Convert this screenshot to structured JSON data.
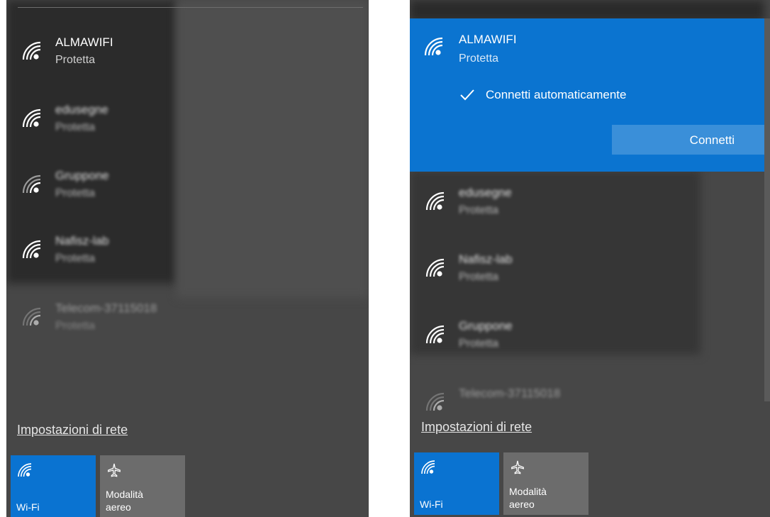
{
  "left_panel": {
    "networks": [
      {
        "name": "ALMAWIFI",
        "status": "Protetta"
      },
      {
        "name": "edusegne",
        "status": "Protetta"
      },
      {
        "name": "Gruppone",
        "status": "Protetta"
      },
      {
        "name": "Nafisz-lab",
        "status": "Protetta"
      },
      {
        "name": "Telecom-37115018",
        "status": "Protetta"
      }
    ],
    "settings_link": "Impostazioni di rete",
    "tiles": {
      "wifi_label": "Wi-Fi",
      "airplane_label_1": "Modalità",
      "airplane_label_2": "aereo"
    }
  },
  "right_panel": {
    "selected": {
      "name": "ALMAWIFI",
      "status": "Protetta",
      "auto_connect_label": "Connetti automaticamente",
      "auto_connect_checked": true,
      "connect_button": "Connetti"
    },
    "networks": [
      {
        "name": "edusegne",
        "status": "Protetta"
      },
      {
        "name": "Nafisz-lab",
        "status": "Protetta"
      },
      {
        "name": "Gruppone",
        "status": "Protetta"
      },
      {
        "name": "Telecom-37115018",
        "status": ""
      }
    ],
    "settings_link": "Impostazioni di rete",
    "tiles": {
      "wifi_label": "Wi-Fi",
      "airplane_label_1": "Modalità",
      "airplane_label_2": "aereo"
    }
  },
  "colors": {
    "accent": "#0b74d0",
    "panel": "#474747"
  },
  "icons": [
    "wifi-signal-icon",
    "check-icon",
    "airplane-icon"
  ]
}
